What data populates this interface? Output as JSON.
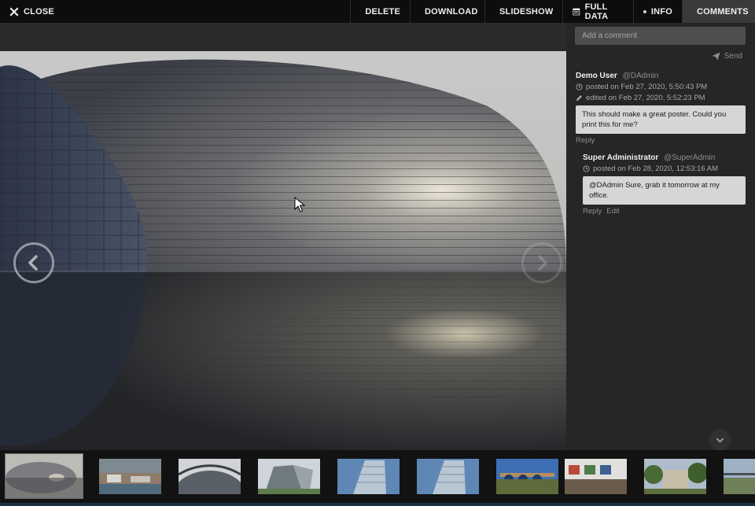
{
  "toolbar": {
    "close": "CLOSE",
    "delete": "DELETE",
    "download": "DOWNLOAD",
    "slideshow": "SLIDESHOW",
    "full_data": "FULL DATA",
    "info": "INFO",
    "comments": "COMMENTS",
    "active_tab": "COMMENTS"
  },
  "viewer": {
    "image_subject": "curved glass dome building reflected in water",
    "prev_icon": "chevron-left-circle-icon",
    "next_icon": "chevron-right-circle-icon"
  },
  "comments": {
    "input_placeholder": "Add a comment",
    "send_label": "Send",
    "items": [
      {
        "author": "Demo User",
        "handle": "@DAdmin",
        "posted": "posted on Feb 27, 2020, 5:50:43 PM",
        "edited": "edited on Feb 27, 2020, 5:52:23 PM",
        "text": "This should make a great poster. Could you print this for me?",
        "actions": [
          "Reply"
        ]
      },
      {
        "author": "Super Administrator",
        "handle": "@SuperAdmin",
        "posted": "posted on Feb 28, 2020, 12:53:16 AM",
        "text": "@DAdmin Sure, grab it tomorrow at my office.",
        "actions": [
          "Reply",
          "Edit"
        ]
      }
    ]
  },
  "filmstrip": {
    "selected_index": 0,
    "thumbnails": [
      {
        "subject": "dome building"
      },
      {
        "subject": "harbor boats"
      },
      {
        "subject": "curved architecture"
      },
      {
        "subject": "modern building"
      },
      {
        "subject": "tower block"
      },
      {
        "subject": "tower block"
      },
      {
        "subject": "arch bridge"
      },
      {
        "subject": "office interior"
      },
      {
        "subject": "house with trees"
      },
      {
        "subject": "bridge landscape"
      }
    ]
  },
  "colors": {
    "toolbar_bg": "#0d0d0d",
    "active_tab_bg": "#3a3a3a",
    "panel_bg": "#262626",
    "bubble_bg": "#d6d6d6"
  }
}
